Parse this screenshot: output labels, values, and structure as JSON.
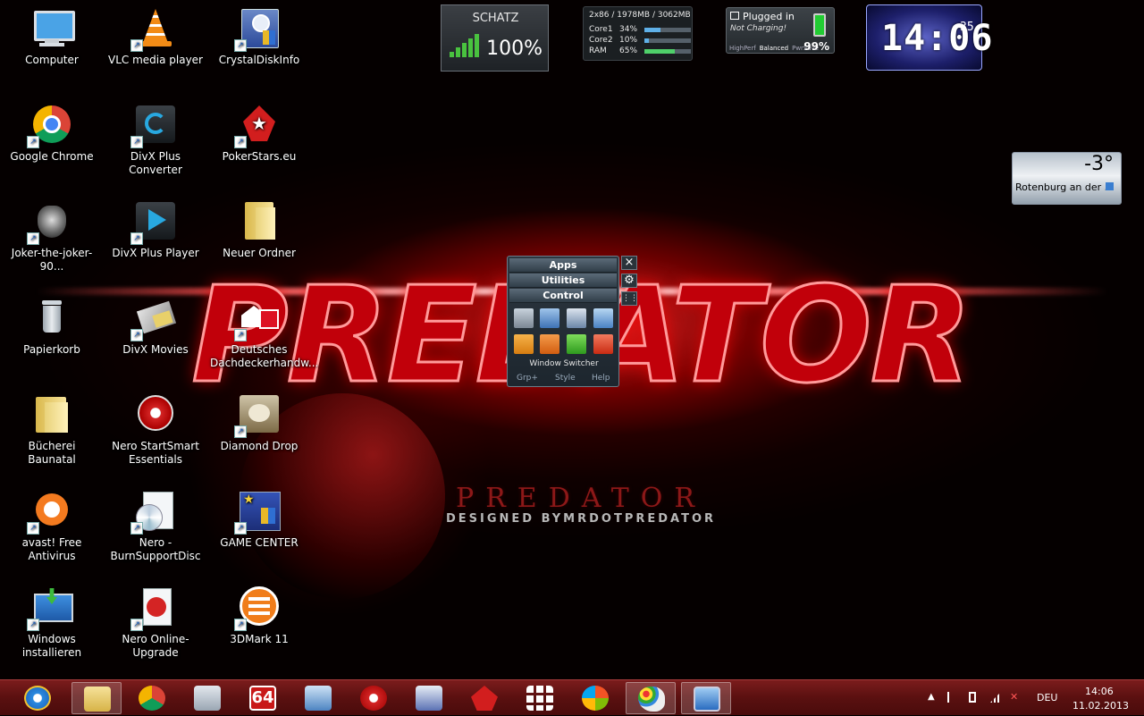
{
  "desktop": {
    "icons": [
      {
        "label": "Computer",
        "icon": "computer-icon"
      },
      {
        "label": "VLC media player",
        "icon": "vlc-icon"
      },
      {
        "label": "CrystalDiskInfo",
        "icon": "crystaldiskinfo-icon"
      },
      {
        "label": "Google Chrome",
        "icon": "chrome-icon"
      },
      {
        "label": "DivX Plus Converter",
        "icon": "divx-converter-icon"
      },
      {
        "label": "PokerStars.eu",
        "icon": "pokerstars-icon"
      },
      {
        "label": "Joker-the-joker-90...",
        "icon": "joker-image-icon"
      },
      {
        "label": "DivX Plus Player",
        "icon": "divx-player-icon"
      },
      {
        "label": "Neuer Ordner",
        "icon": "folder-icon"
      },
      {
        "label": "Papierkorb",
        "icon": "recycle-bin-icon"
      },
      {
        "label": "DivX Movies",
        "icon": "divx-movies-icon"
      },
      {
        "label": "Deutsches Dachdeckerhandw...",
        "icon": "web-shortcut-icon"
      },
      {
        "label": "Bücherei Baunatal",
        "icon": "folder-icon"
      },
      {
        "label": "Nero StartSmart Essentials",
        "icon": "nero-icon"
      },
      {
        "label": "Diamond Drop",
        "icon": "diamond-drop-icon"
      },
      {
        "label": "avast! Free Antivirus",
        "icon": "avast-icon"
      },
      {
        "label": "Nero - BurnSupportDisc",
        "icon": "nero-disc-icon"
      },
      {
        "label": "GAME CENTER",
        "icon": "game-center-icon"
      },
      {
        "label": "Windows installieren",
        "icon": "windows-install-icon"
      },
      {
        "label": "Nero Online-Upgrade",
        "icon": "nero-upgrade-icon"
      },
      {
        "label": "3DMark 11",
        "icon": "3dmark-icon"
      }
    ]
  },
  "wallpaper": {
    "title_big": "PREDATOR",
    "title_small": "PREDATOR",
    "credit": "DESIGNED BYMRDOTPREDATOR"
  },
  "wifi_gadget": {
    "network": "SCHATZ",
    "signal": "100%",
    "signal_level": 1.0
  },
  "cpu_gadget": {
    "header": "2x86 / 1978MB / 3062MB",
    "rows": [
      {
        "label": "Core1",
        "value": "34%",
        "fraction": 0.34,
        "color": "#5fb0e8"
      },
      {
        "label": "Core2",
        "value": "10%",
        "fraction": 0.1,
        "color": "#5fb0e8"
      },
      {
        "label": "RAM",
        "value": "65%",
        "fraction": 0.65,
        "color": "#4fd06a"
      }
    ]
  },
  "battery_gadget": {
    "status": "Plugged in",
    "charging": "Not Charging!",
    "modes": [
      "HighPerf",
      "Balanced",
      "PwrSave"
    ],
    "active_mode": "Balanced",
    "percent": "99%",
    "level": 0.99
  },
  "clock_gadget": {
    "time": "14:06",
    "seconds": "35"
  },
  "weather_gadget": {
    "temperature": "-3°",
    "city": "Rotenburg an der ..."
  },
  "launcher_gadget": {
    "tabs": [
      "Apps",
      "Utilities",
      "Control"
    ],
    "caption": "Window Switcher",
    "footer": [
      "Grp+",
      "Style",
      "Help"
    ],
    "buttons": [
      "recycle-icon",
      "folder-icon",
      "display-icon",
      "network-icon",
      "lock-icon",
      "power-icon",
      "restart-icon",
      "shutdown-icon"
    ]
  },
  "taskbar": {
    "pinned": [
      "internet-explorer-icon",
      "file-explorer-icon",
      "chrome-icon",
      "calculator-icon",
      "64bit-icon",
      "network-settings-icon",
      "nero-icon",
      "disc-burner-icon",
      "pokerstars-icon",
      "metro-grid-icon",
      "windows-logo-icon",
      "paint-icon",
      "remote-desktop-icon"
    ],
    "tray": {
      "language": "DEU",
      "time": "14:06",
      "date": "11.02.2013"
    }
  }
}
